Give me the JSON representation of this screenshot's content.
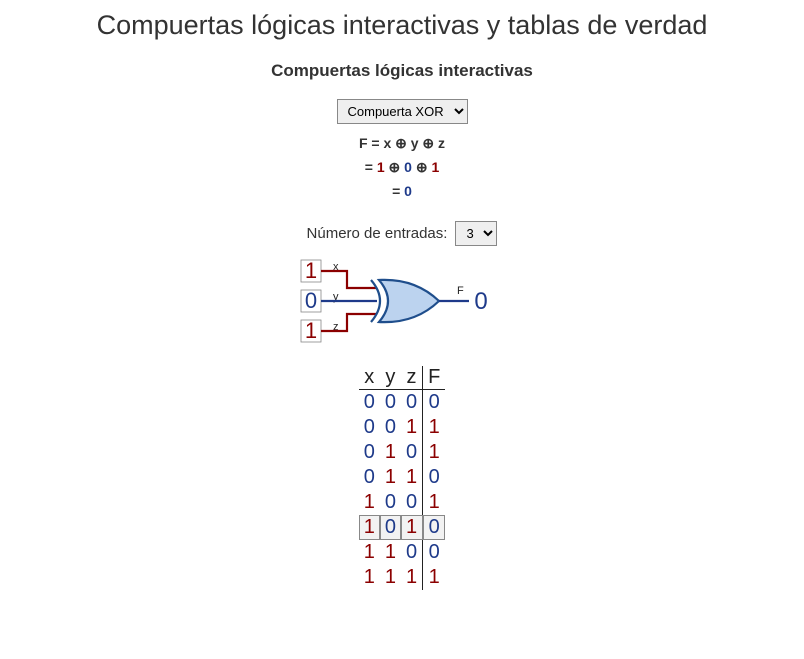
{
  "title": "Compuertas lógicas interactivas y tablas de verdad",
  "subtitle": "Compuertas lógicas interactivas",
  "gate_select": {
    "value": "Compuerta XOR"
  },
  "formula": {
    "line1_prefix": "F = ",
    "line1_expr": "x ⊕ y ⊕ z",
    "line2_prefix": "= ",
    "line2_v1": "1",
    "line2_op1": " ⊕ ",
    "line2_v2": "0",
    "line2_op2": " ⊕ ",
    "line2_v3": "1",
    "line3_prefix": "= ",
    "line3_result": "0"
  },
  "inputs_label": "Número de entradas:",
  "inputs_select": {
    "value": "3"
  },
  "gate": {
    "in_labels": [
      "x",
      "y",
      "z"
    ],
    "in_values": [
      "1",
      "0",
      "1"
    ],
    "out_label": "F",
    "out_value": "0"
  },
  "truth": {
    "headers": [
      "x",
      "y",
      "z",
      "F"
    ],
    "rows": [
      {
        "x": "0",
        "y": "0",
        "z": "0",
        "F": "0",
        "selected": false
      },
      {
        "x": "0",
        "y": "0",
        "z": "1",
        "F": "1",
        "selected": false
      },
      {
        "x": "0",
        "y": "1",
        "z": "0",
        "F": "1",
        "selected": false
      },
      {
        "x": "0",
        "y": "1",
        "z": "1",
        "F": "0",
        "selected": false
      },
      {
        "x": "1",
        "y": "0",
        "z": "0",
        "F": "1",
        "selected": false
      },
      {
        "x": "1",
        "y": "0",
        "z": "1",
        "F": "0",
        "selected": true
      },
      {
        "x": "1",
        "y": "1",
        "z": "0",
        "F": "0",
        "selected": false
      },
      {
        "x": "1",
        "y": "1",
        "z": "1",
        "F": "1",
        "selected": false
      }
    ]
  }
}
